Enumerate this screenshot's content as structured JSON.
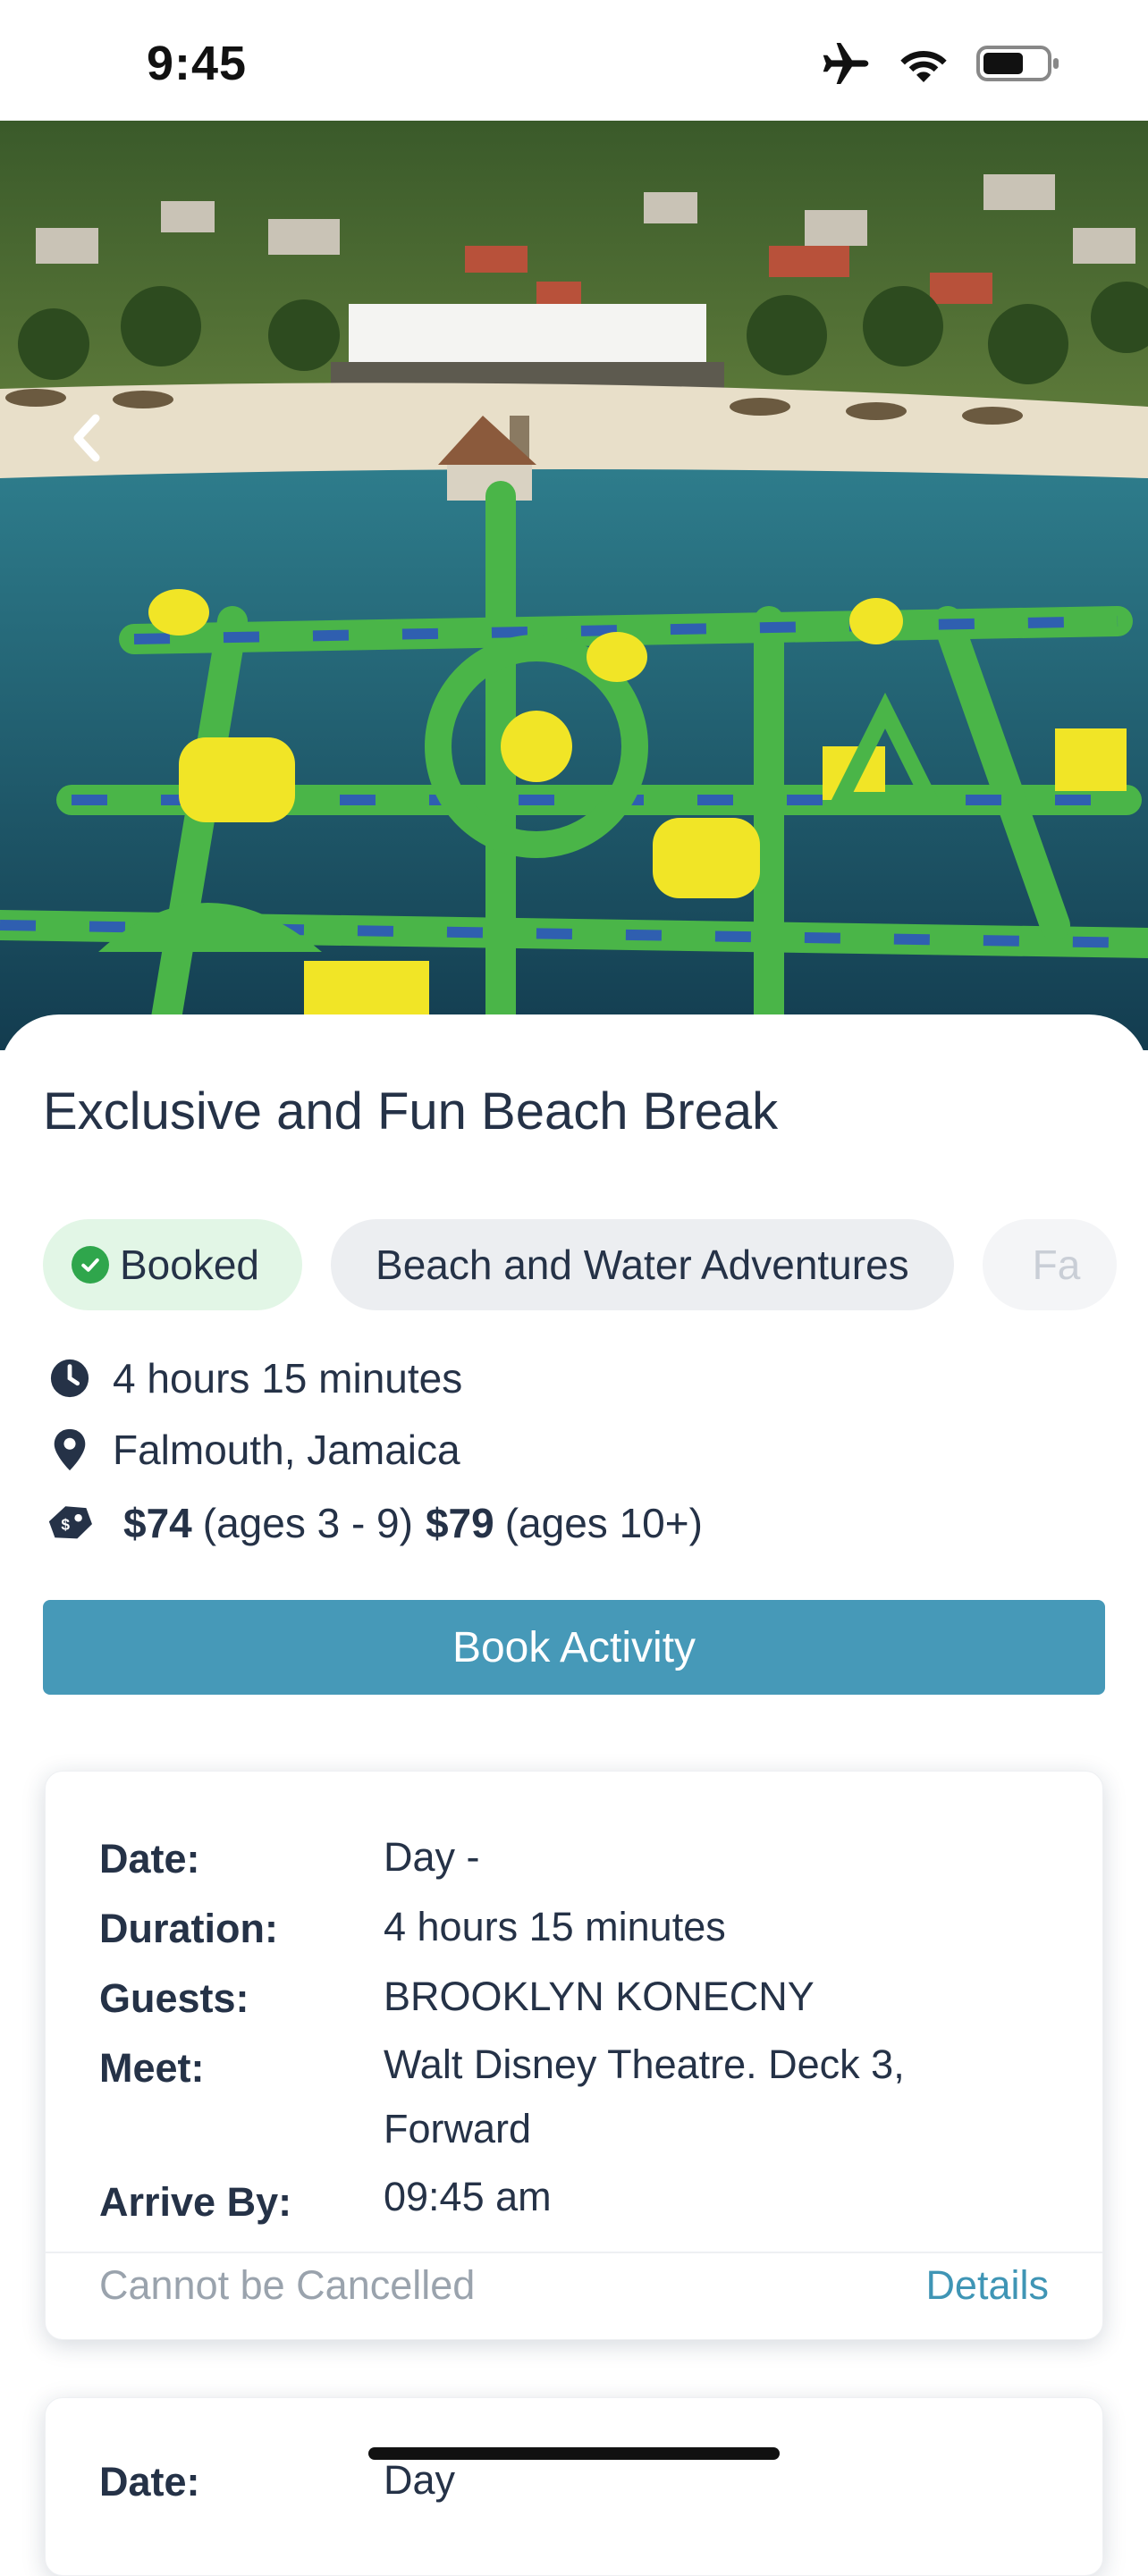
{
  "status": {
    "time": "9:45"
  },
  "activity": {
    "title": "Exclusive and Fun Beach Break",
    "chips": [
      "Booked",
      "Beach and Water Adventures",
      "Fa"
    ],
    "duration": "4 hours 15 minutes",
    "location": "Falmouth, Jamaica",
    "price": {
      "child_price": "$74",
      "child_ages": "(ages 3 - 9)",
      "adult_price": "$79",
      "adult_ages": "(ages 10+)"
    },
    "book_button": "Book Activity"
  },
  "booking_card": {
    "labels": {
      "date": "Date:",
      "duration": "Duration:",
      "guests": "Guests:",
      "meet": "Meet:",
      "arrive_by": "Arrive By:"
    },
    "values": {
      "date": "Day -",
      "duration": "4 hours 15 minutes",
      "guests": "BROOKLYN KONECNY",
      "meet": "Walt Disney Theatre. Deck 3, Forward",
      "arrive_by": "09:45 am"
    },
    "cancel_status": "Cannot be Cancelled",
    "details_link": "Details"
  },
  "booking_card_2": {
    "date_label": "Date:",
    "date_value": "Day"
  },
  "colors": {
    "primary": "#4699b8",
    "booked_bg": "#e2f6e6",
    "booked_icon": "#2fa64c",
    "text": "#253247"
  }
}
